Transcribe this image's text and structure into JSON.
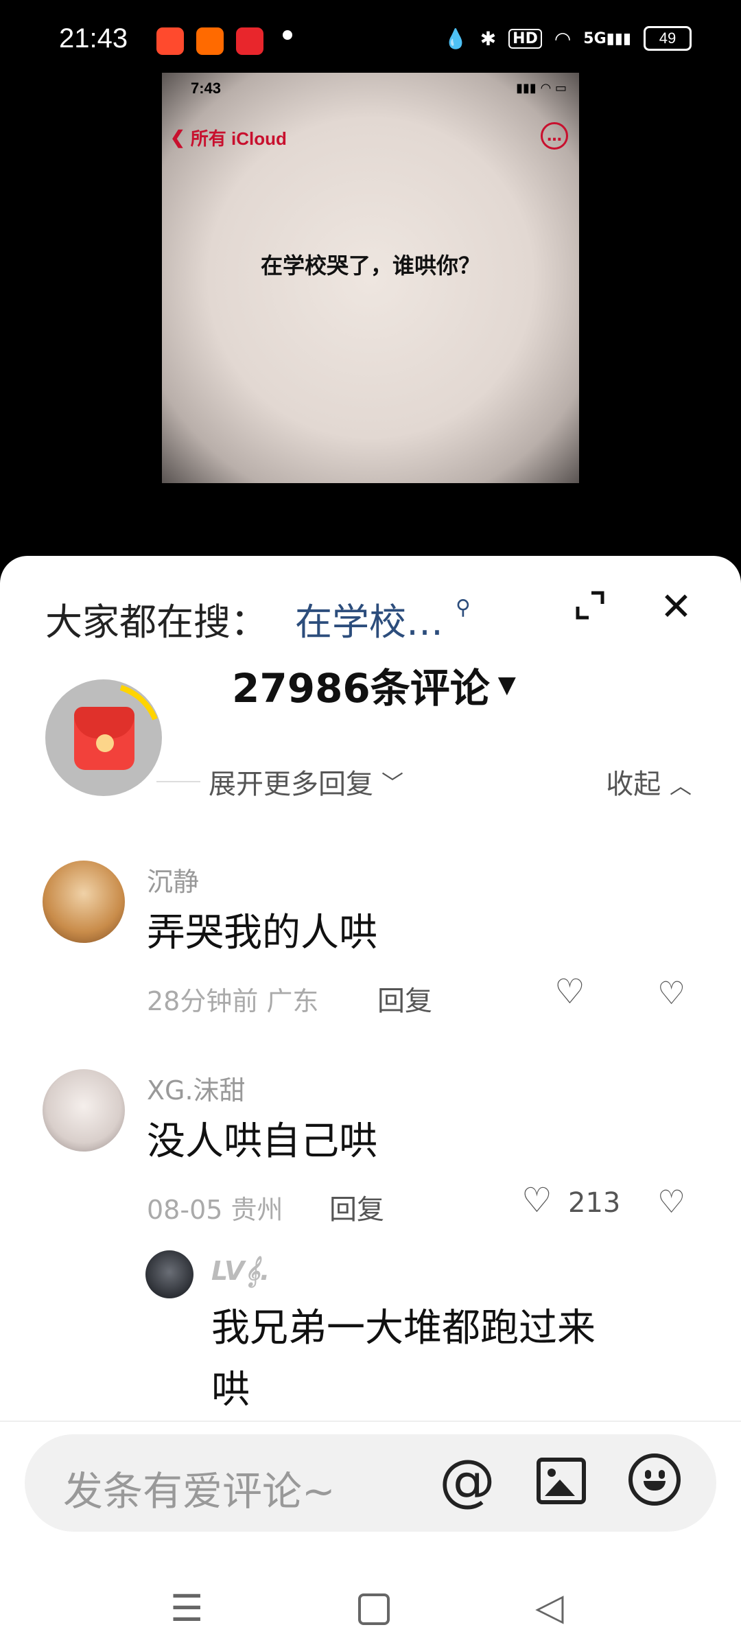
{
  "status": {
    "time": "21:43",
    "battery": "49",
    "network": "5G",
    "hd": "HD"
  },
  "media": {
    "phone_time": "7:43",
    "back_label": "所有 iCloud",
    "note_text": "在学校哭了，谁哄你？"
  },
  "sheet": {
    "search_prefix": "大家都在搜：",
    "search_term": "在学校…",
    "comment_count": "27986条评论",
    "expand_more": "展开更多回复",
    "collapse": "收起"
  },
  "comments": [
    {
      "user": "沉静",
      "text": "弄哭我的人哄",
      "meta": "28分钟前 广东",
      "reply": "回复",
      "likes": ""
    },
    {
      "user": "XG.沫甜",
      "text": "没人哄自己哄",
      "meta": "08-05 贵州",
      "reply": "回复",
      "likes": "213"
    }
  ],
  "sub_reply": {
    "user": "LV𝄞.",
    "text_line1": "我兄弟一大堆都跑过来",
    "text_line2": "哄"
  },
  "input": {
    "placeholder": "发条有爱评论~"
  },
  "colors": {
    "link_blue": "#2c4d7c",
    "icloud_red": "#c8102e",
    "redpacket": "#f2413b"
  }
}
